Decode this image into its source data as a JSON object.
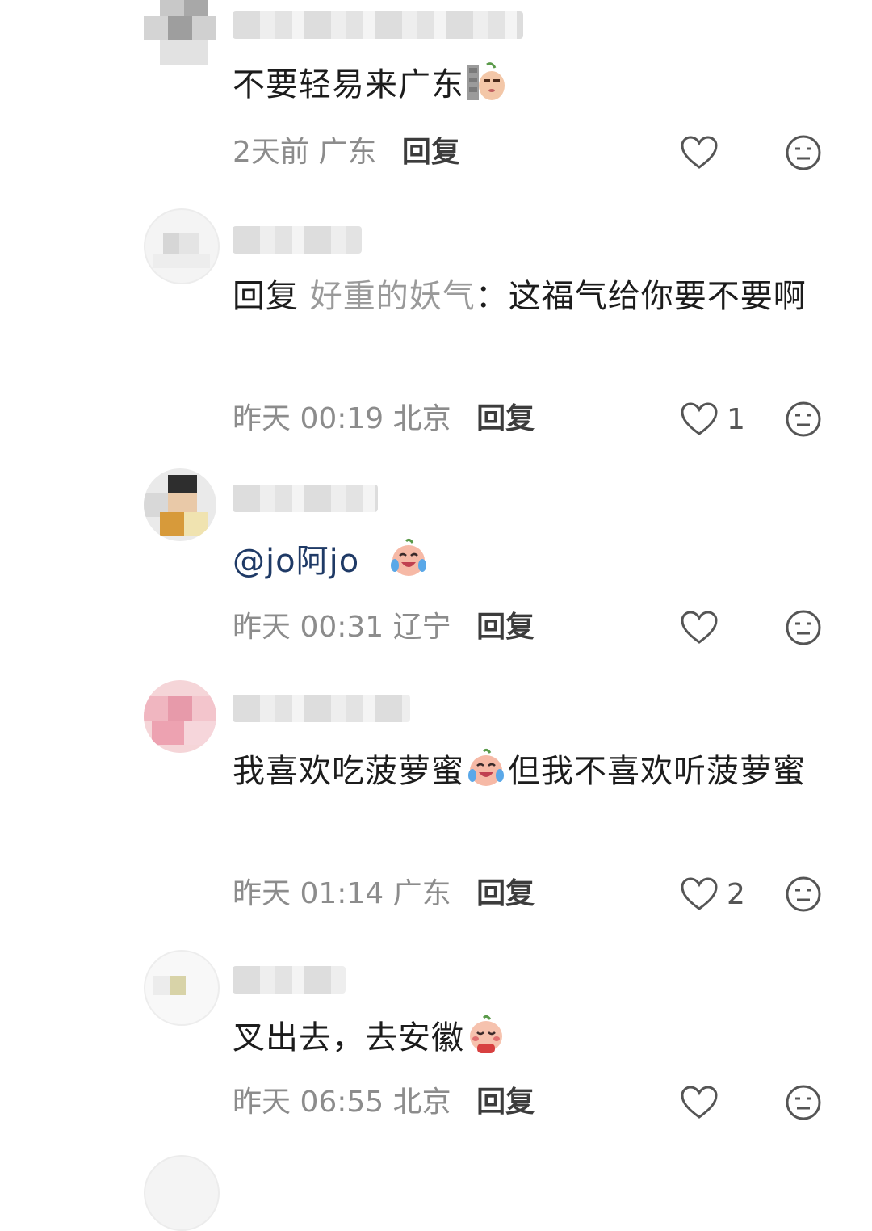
{
  "comments": [
    {
      "text_parts": [
        {
          "kind": "plain",
          "text": "不要轻易来广东"
        }
      ],
      "emoji": "sweat-wall-emoji",
      "time": "2天前",
      "location": "广东",
      "reply_label": "回复",
      "likes": ""
    },
    {
      "text_parts": [
        {
          "kind": "reply-kw",
          "text": "回复 "
        },
        {
          "kind": "reply-to",
          "text": "好重的妖气"
        },
        {
          "kind": "plain",
          "text": "：这福气给你要不要啊"
        }
      ],
      "time": "昨天 00:19",
      "location": "北京",
      "reply_label": "回复",
      "likes": "1"
    },
    {
      "text_parts": [
        {
          "kind": "mention",
          "text": "@jo阿jo"
        }
      ],
      "emoji": "crying-laugh-emoji",
      "time": "昨天 00:31",
      "location": "辽宁",
      "reply_label": "回复",
      "likes": ""
    },
    {
      "text_parts": [
        {
          "kind": "plain",
          "text": "我喜欢吃菠萝蜜"
        },
        {
          "kind": "emoji",
          "text": "crying-laugh-emoji"
        },
        {
          "kind": "plain",
          "text": "但我不喜欢听菠萝蜜"
        }
      ],
      "time": "昨天 01:14",
      "location": "广东",
      "reply_label": "回复",
      "likes": "2"
    },
    {
      "text_parts": [
        {
          "kind": "plain",
          "text": "叉出去，去安徽"
        }
      ],
      "emoji": "praying-emoji",
      "time": "昨天 06:55",
      "location": "北京",
      "reply_label": "回复",
      "likes": ""
    }
  ],
  "colors": {
    "text": "#1c1c1c",
    "meta": "#8c8c8c",
    "mention": "#1f3a66",
    "icon": "#555555"
  }
}
